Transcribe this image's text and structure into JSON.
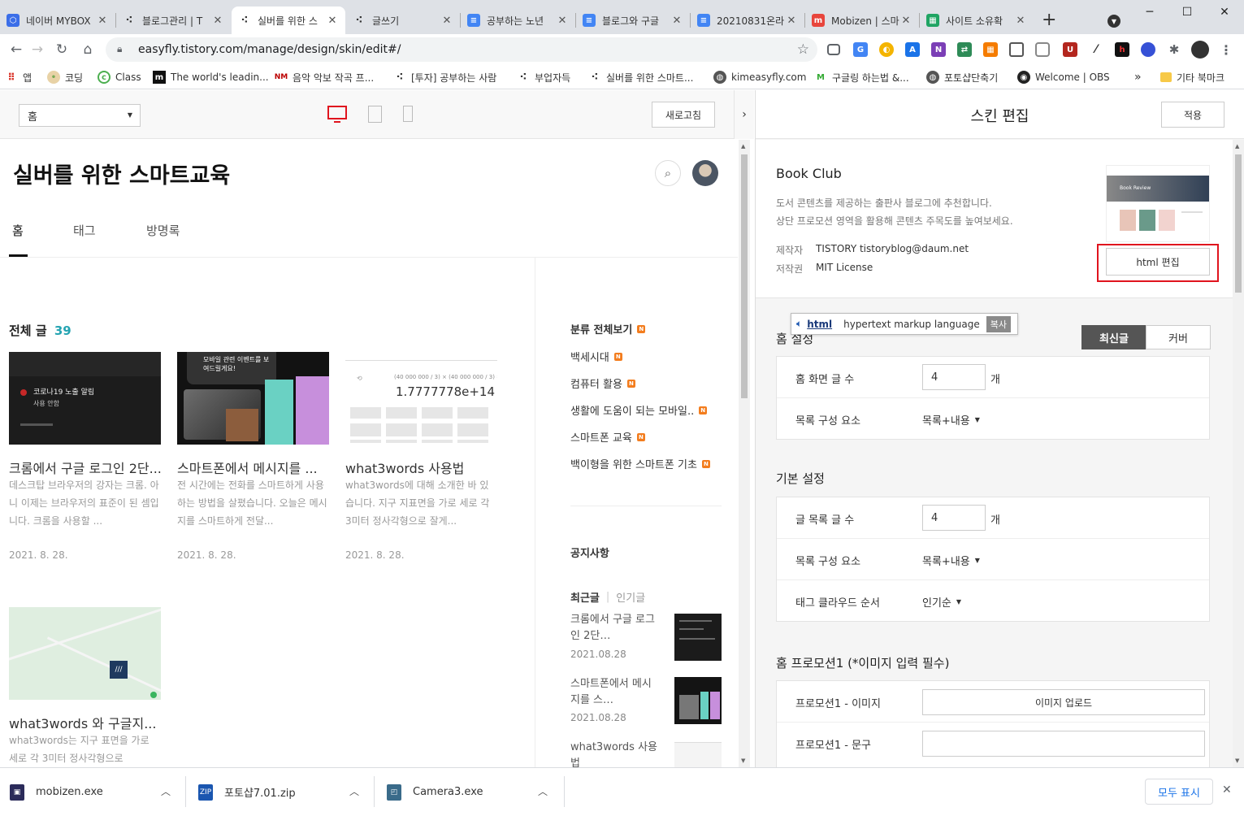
{
  "browser": {
    "tabs": [
      {
        "title": "네이버 MYBOX",
        "favicon_color": "#3b6ee8"
      },
      {
        "title": "블로그관리 | T",
        "favicon_color": "#333333"
      },
      {
        "title": "실버를 위한 스",
        "favicon_color": "#333333"
      },
      {
        "title": "글쓰기",
        "favicon_color": "#333333"
      },
      {
        "title": "공부하는 노년",
        "favicon_color": "#4285f4"
      },
      {
        "title": "블로그와 구글",
        "favicon_color": "#4285f4"
      },
      {
        "title": "20210831온라",
        "favicon_color": "#4285f4"
      },
      {
        "title": "Mobizen | 스마",
        "favicon_color": "#e8453c"
      },
      {
        "title": "사이트 소유확",
        "favicon_color": "#1fa463"
      }
    ],
    "new_tab": "+",
    "url": "easyfly.tistory.com/manage/design/skin/edit#/",
    "bookmarks": [
      {
        "label": "앱",
        "icon": "apps-grid-icon"
      },
      {
        "label": "코딩",
        "icon": "dog-icon"
      },
      {
        "label": "Class",
        "icon": "class-icon"
      },
      {
        "label": "The world's leadin...",
        "icon": "m-logo-icon"
      },
      {
        "label": "음악 악보 작곡 프...",
        "icon": "music-icon"
      },
      {
        "label": "[투자] 공부하는 사람",
        "icon": "tistory-icon"
      },
      {
        "label": "부업자득",
        "icon": "tistory-icon"
      },
      {
        "label": "실버를 위한 스마트...",
        "icon": "tistory-icon"
      },
      {
        "label": "kimeasyfly.com",
        "icon": "globe-icon"
      },
      {
        "label": "구글링 하는법 &...",
        "icon": "m-green-icon"
      },
      {
        "label": "포토샵단축기",
        "icon": "globe-icon"
      },
      {
        "label": "Welcome | OBS",
        "icon": "obs-icon"
      }
    ],
    "bookmarks_more": "»",
    "other_bookmarks": "기타 북마크"
  },
  "editor": {
    "page_select": "홈",
    "refresh_button": "새로고침",
    "panel_title": "스킨 편집",
    "apply_button": "적용"
  },
  "blog": {
    "title": "실버를 위한 스마트교육",
    "nav": [
      "홈",
      "태그",
      "방명록"
    ],
    "all_posts_label": "전체 글",
    "all_posts_count": "39",
    "posts": [
      {
        "title": "크롬에서 구글 로그인 2단...",
        "excerpt": "데스크탑 브라우저의 강자는 크롬. 아니 이제는 브라우저의 표준이 된 셈입니다. 크롬을 사용할 ...",
        "date": "2021. 8. 28.",
        "thumb_text1": "코로나19 노출 알림",
        "thumb_text2": "사용 안함"
      },
      {
        "title": "스마트폰에서 메시지를 ...",
        "excerpt": "전 시간에는 전화를 스마트하게 사용하는 방법을 살폈습니다. 오늘은 메시지를 스마트하게 전달...",
        "date": "2021. 8. 28.",
        "thumb_text1": "모바일 관련 이벤트를 보여드릴게요!"
      },
      {
        "title": "what3words 사용법",
        "excerpt": "what3words에 대해 소개한 바 있습니다. 지구 지표면을 가로 세로 각 3미터 정사각형으로 잘게...",
        "date": "2021. 8. 28.",
        "thumb_text1": "(40 000 000 / 3) × (40 000 000 / 3) =",
        "thumb_text2": "1.7777778e+14"
      },
      {
        "title": "what3words 와 구글지...",
        "excerpt": "what3words는 지구 표면을 가로 세로 각 3미터 정사각형으로",
        "date": "",
        "thumb_text1": "///"
      }
    ],
    "sidebar": {
      "category_all": "분류 전체보기",
      "categories": [
        "백세시대",
        "컴퓨터 활용",
        "생활에 도움이 되는 모바일..",
        "스마트폰 교육",
        "백이형을 위한 스마트폰 기초"
      ],
      "notice_title": "공지사항",
      "recent_tab": "최근글",
      "popular_tab": "인기글",
      "recent_posts": [
        {
          "title": "크롬에서 구글 로그인 2단…",
          "date": "2021.08.28"
        },
        {
          "title": "스마트폰에서 메시지를 스…",
          "date": "2021.08.28"
        },
        {
          "title": "what3words 사용법",
          "date": ""
        }
      ]
    }
  },
  "skin": {
    "name": "Book Club",
    "description1": "도서 콘텐츠를 제공하는 출판사 블로그에 추천합니다.",
    "description2": "상단 프로모션 영역을 활용해 콘텐츠 주목도를 높여보세요.",
    "maker_label": "제작자",
    "maker_value": "TISTORY tistoryblog@daum.net",
    "license_label": "저작권",
    "license_value": "MIT License",
    "html_edit_button": "html 편집",
    "thumb_text": "Book Review",
    "tooltip": {
      "word": "html",
      "meaning": "hypertext markup language",
      "copy": "복사"
    },
    "home_settings_title": "홈 설정",
    "home_tabs": [
      "최신글",
      "커버"
    ],
    "home_post_count_label": "홈 화면 글 수",
    "home_post_count": "4",
    "unit": "개",
    "list_composition_label": "목록 구성 요소",
    "list_composition_value": "목록+내용",
    "basic_settings_title": "기본 설정",
    "post_list_count_label": "글 목록 글 수",
    "post_list_count": "4",
    "list_composition_value2": "목록+내용",
    "tag_cloud_label": "태그 클라우드 순서",
    "tag_cloud_value": "인기순",
    "promotion_title": "홈 프로모션1 (*이미지 입력 필수)",
    "promo_image_label": "프로모션1 - 이미지",
    "promo_upload_button": "이미지 업로드",
    "promo_text_label": "프로모션1 - 문구",
    "promo_text_value": ""
  },
  "downloads": {
    "items": [
      {
        "name": "mobizen.exe"
      },
      {
        "name": "포토샵7.01.zip"
      },
      {
        "name": "Camera3.exe"
      }
    ],
    "show_all": "모두 표시",
    "close": "✕"
  },
  "colors": {
    "accent_teal": "#25a4b2",
    "highlight_red": "#e0141e",
    "badge_orange": "#f37d1e",
    "tab_active_dark": "#555555"
  }
}
